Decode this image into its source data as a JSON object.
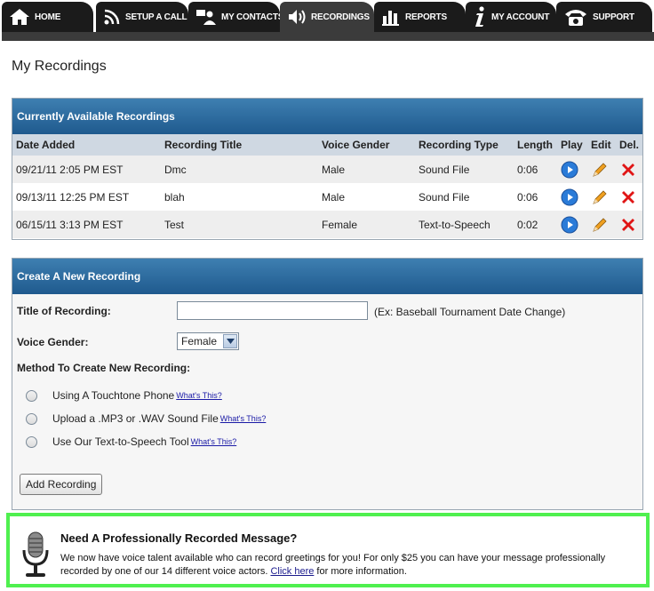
{
  "nav": {
    "tabs": [
      {
        "label": "HOME",
        "icon": "home-icon"
      },
      {
        "label": "SETUP A CALL",
        "icon": "signal-icon"
      },
      {
        "label": "MY CONTACTS",
        "icon": "contacts-icon"
      },
      {
        "label": "RECORDINGS",
        "icon": "speaker-icon"
      },
      {
        "label": "REPORTS",
        "icon": "bar-chart-icon"
      },
      {
        "label": "MY ACCOUNT",
        "icon": "info-icon"
      },
      {
        "label": "SUPPORT",
        "icon": "phone-icon"
      }
    ],
    "active": "RECORDINGS"
  },
  "page": {
    "title": "My Recordings"
  },
  "available": {
    "heading": "Currently Available Recordings",
    "columns": [
      "Date Added",
      "Recording Title",
      "Voice Gender",
      "Recording Type",
      "Length",
      "Play",
      "Edit",
      "Del."
    ],
    "rows": [
      {
        "date": "09/21/11 2:05 PM EST",
        "title": "Dmc",
        "gender": "Male",
        "type": "Sound File",
        "length": "0:06"
      },
      {
        "date": "09/13/11 12:25 PM EST",
        "title": "blah",
        "gender": "Male",
        "type": "Sound File",
        "length": "0:06"
      },
      {
        "date": "06/15/11 3:13 PM EST",
        "title": "Test",
        "gender": "Female",
        "type": "Text-to-Speech",
        "length": "0:02"
      }
    ]
  },
  "create": {
    "heading": "Create A New Recording",
    "title_label": "Title of Recording:",
    "title_value": "",
    "title_hint": "(Ex: Baseball Tournament Date Change)",
    "gender_label": "Voice Gender:",
    "gender_value": "Female",
    "method_label": "Method To Create New Recording:",
    "methods": [
      {
        "label": "Using A Touchtone Phone",
        "help": "What's This?"
      },
      {
        "label": "Upload a .MP3 or .WAV Sound File",
        "help": "What's This?"
      },
      {
        "label": "Use Our Text-to-Speech Tool",
        "help": "What's This?"
      }
    ],
    "add_button": "Add Recording"
  },
  "promo": {
    "heading": "Need A Professionally Recorded Message?",
    "text_before": "We now have voice talent available who can record greetings for you! For only $25 you can have your message professionally recorded by one of our 14 different voice actors.",
    "link": "Click here",
    "text_after": "for more information."
  },
  "colors": {
    "header_blue": "#2a6aa0",
    "nav_dark": "#1b1b1b",
    "promo_border": "#4ff04f",
    "play_blue": "#2a7bd8",
    "delete_red": "#e01515",
    "edit_orange": "#f0a020"
  }
}
